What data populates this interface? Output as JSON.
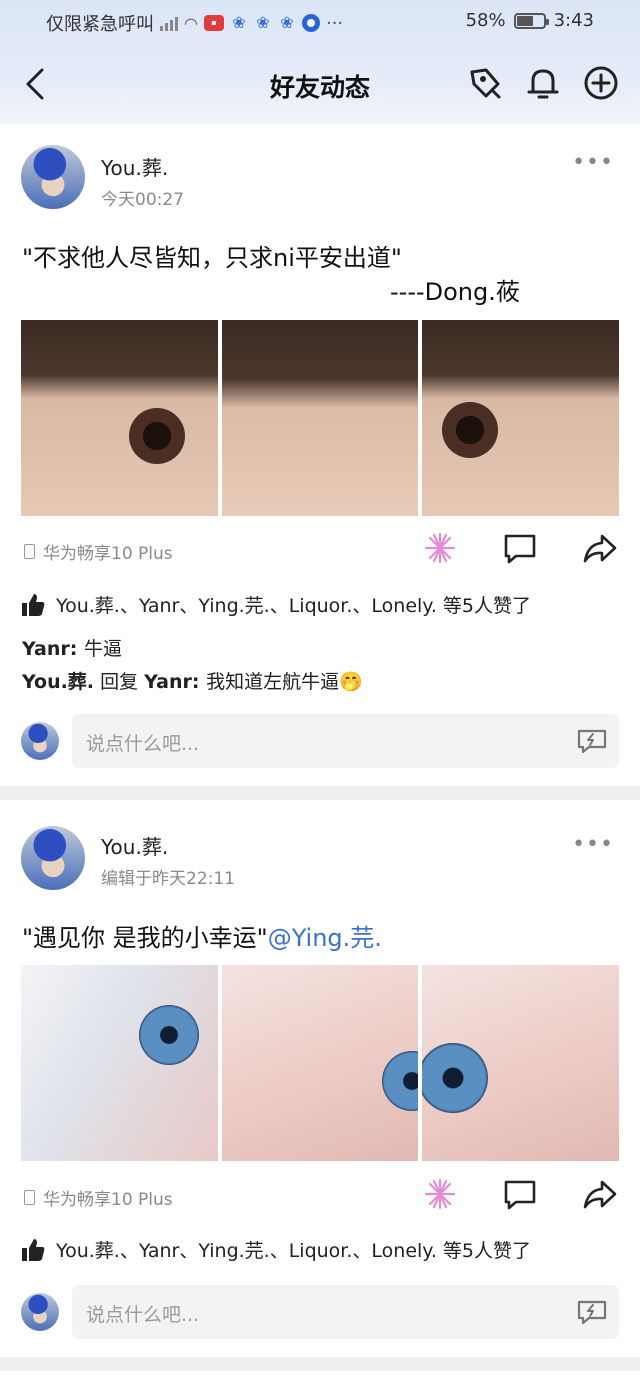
{
  "status_bar": {
    "carrier": "仅限紧急呼叫",
    "battery": "58%",
    "time": "3:43"
  },
  "header": {
    "title": "好友动态"
  },
  "posts": [
    {
      "author": "You.葬.",
      "time": "今天00:27",
      "text": "\"不求他人尽皆知，只求ni平安出道\"",
      "signature": "----Dong.莜",
      "device": "华为畅享10 Plus",
      "likes": "You.葬.、Yanr、Ying.芫.、Liquor.、Lonely. 等5人赞了",
      "comments": [
        {
          "user": "Yanr",
          "sep": ": ",
          "text": "牛逼"
        },
        {
          "user": "You.葬.",
          "mid": " 回复 ",
          "to": "Yanr",
          "sep": ": ",
          "text": "我知道左航牛逼🤭"
        }
      ],
      "reply_placeholder": "说点什么吧..."
    },
    {
      "author": "You.葬.",
      "time": "编辑于昨天22:11",
      "text": "\"遇见你  是我的小幸运\"",
      "mention": "@Ying.芫.",
      "device": "华为畅享10 Plus",
      "likes": "You.葬.、Yanr、Ying.芫.、Liquor.、Lonely. 等5人赞了",
      "reply_placeholder": "说点什么吧..."
    }
  ],
  "icons": {
    "back": "back-arrow-icon",
    "pin": "pin-icon",
    "bell": "bell-icon",
    "add": "add-circle-icon",
    "more": "more-dots-icon",
    "device": "phone-icon",
    "sparkle": "sparkle-icon",
    "comment": "comment-icon",
    "share": "share-icon",
    "like": "thumbs-up-icon",
    "emoji": "emoji-keyboard-icon"
  }
}
